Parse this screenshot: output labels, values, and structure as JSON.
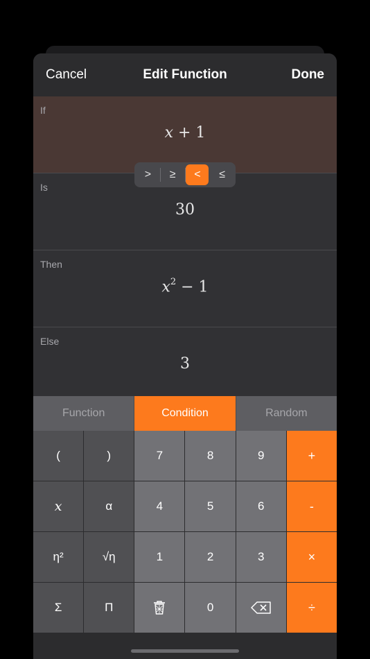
{
  "nav": {
    "cancel": "Cancel",
    "title": "Edit Function",
    "done": "Done"
  },
  "sections": {
    "if": {
      "label": "If",
      "expr_var": "x",
      "expr_rest": " + 1"
    },
    "is": {
      "label": "Is",
      "value": "30"
    },
    "then": {
      "label": "Then",
      "expr_var": "x",
      "expr_exp": "2",
      "expr_rest": " − 1"
    },
    "else": {
      "label": "Else",
      "value": "3"
    }
  },
  "comparators": [
    ">",
    "≥",
    "<",
    "≤"
  ],
  "selected_comparator": "<",
  "tabs": [
    "Function",
    "Condition",
    "Random"
  ],
  "selected_tab": "Condition",
  "keys": [
    "(",
    ")",
    "7",
    "8",
    "9",
    "+",
    "x",
    "α",
    "4",
    "5",
    "6",
    "-",
    "η²",
    "√η",
    "1",
    "2",
    "3",
    "×",
    "Σ",
    "Π",
    "trash-icon",
    "0",
    "backspace-icon",
    "÷"
  ],
  "colors": {
    "accent": "#fd7a1d",
    "sheet": "#2c2c2e",
    "active_section": "#4a3834"
  }
}
